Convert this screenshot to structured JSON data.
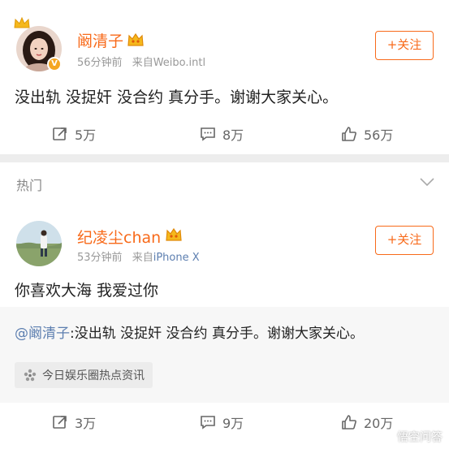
{
  "post": {
    "author": "阚清子",
    "time": "56分钟前",
    "source_prefix": "来自",
    "source": "Weibo.intl",
    "follow_label": "+关注",
    "text": "没出轨 没捉奸 没合约 真分手。谢谢大家关心。",
    "reposts": "5万",
    "comments": "8万",
    "likes": "56万"
  },
  "hot_section": {
    "label": "热门"
  },
  "comment": {
    "author": "纪凌尘chan",
    "time": "53分钟前",
    "source_prefix": "来自",
    "source": "iPhone X",
    "follow_label": "+关注",
    "text": "你喜欢大海 我爱过你",
    "repost_mention": "@阚清子",
    "repost_text": ":没出轨 没捉奸 没合约 真分手。谢谢大家关心。",
    "tag": "今日娱乐圈热点资讯",
    "reposts": "3万",
    "comments": "9万",
    "likes": "20万"
  },
  "watermark": "悟空问答",
  "colors": {
    "accent": "#f86a1a",
    "link": "#5d7fb0",
    "background": "#ededed"
  }
}
